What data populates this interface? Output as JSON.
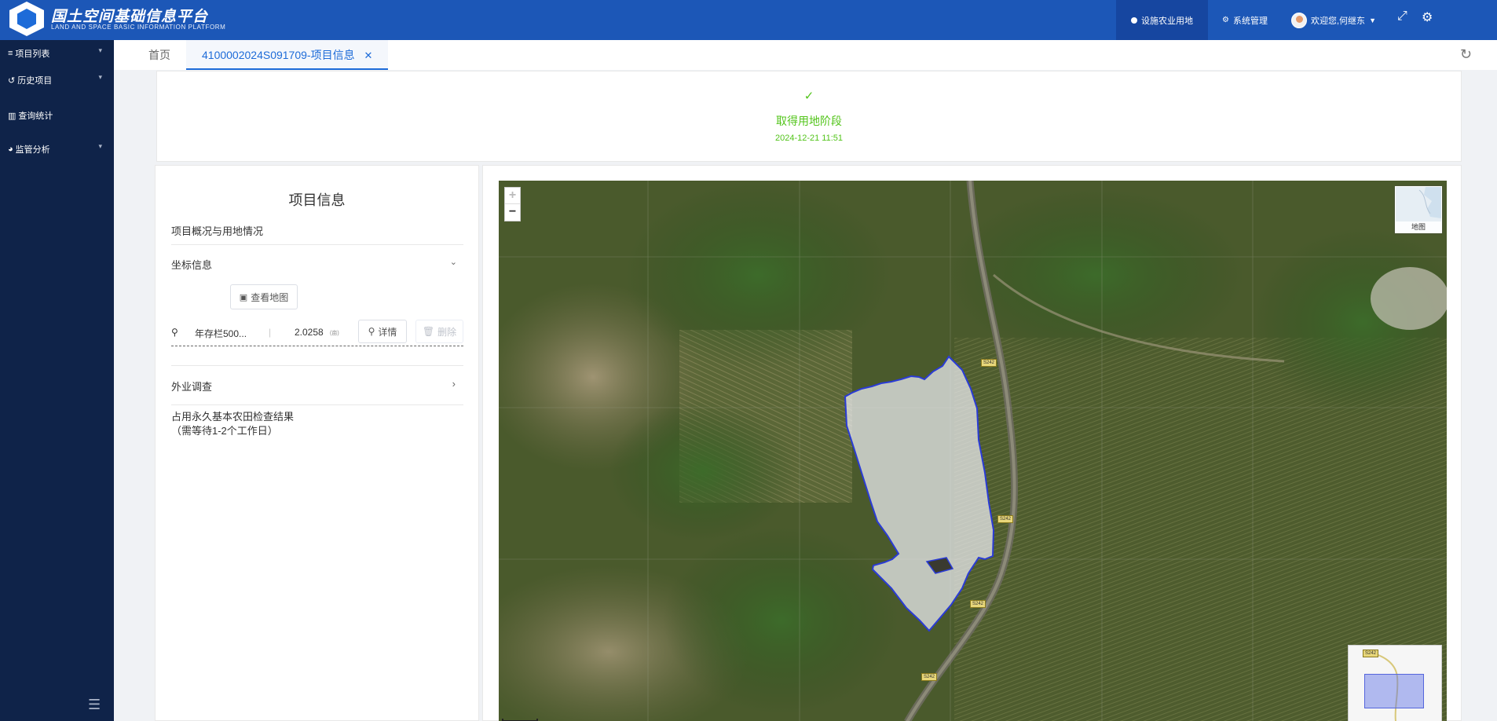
{
  "header": {
    "title": "国土空间基础信息平台",
    "subtitle": "LAND AND SPACE BASIC INFORMATION PLATFORM",
    "nav_active": "设施农业用地",
    "nav_system": "系统管理",
    "welcome": "欢迎您,何继东"
  },
  "sidebar": {
    "items": [
      {
        "label": "项目列表"
      },
      {
        "label": "历史项目"
      },
      {
        "label": "查询统计"
      },
      {
        "label": "监管分析"
      }
    ]
  },
  "tabs": {
    "home": "首页",
    "active": "4100002024S091709-项目信息"
  },
  "status": {
    "stage": "取得用地阶段",
    "time": "2024-12-21 11:51"
  },
  "project": {
    "title": "项目信息",
    "overview_label": "项目概况与用地情况",
    "coord_label": "坐标信息",
    "view_map_btn": "查看地图",
    "parcel_name": "年存栏500...",
    "parcel_area": "2.0258",
    "parcel_unit": "(亩)",
    "detail_btn": "详情",
    "delete_btn": "删除",
    "field_survey": "外业调查",
    "farmland_check_line1": "占用永久基本农田检查结果",
    "farmland_check_line2": "（需等待1-2个工作日）"
  },
  "map": {
    "zoom_in": "+",
    "zoom_out": "−",
    "basemap_label": "地图",
    "road_labels": [
      "S242",
      "S242",
      "S242",
      "S242"
    ],
    "overview_label": "S242"
  },
  "colors": {
    "header_bg": "#1c57b7",
    "sidebar_bg": "#0f2349",
    "accent": "#1d6bd8",
    "success": "#52c41a"
  }
}
